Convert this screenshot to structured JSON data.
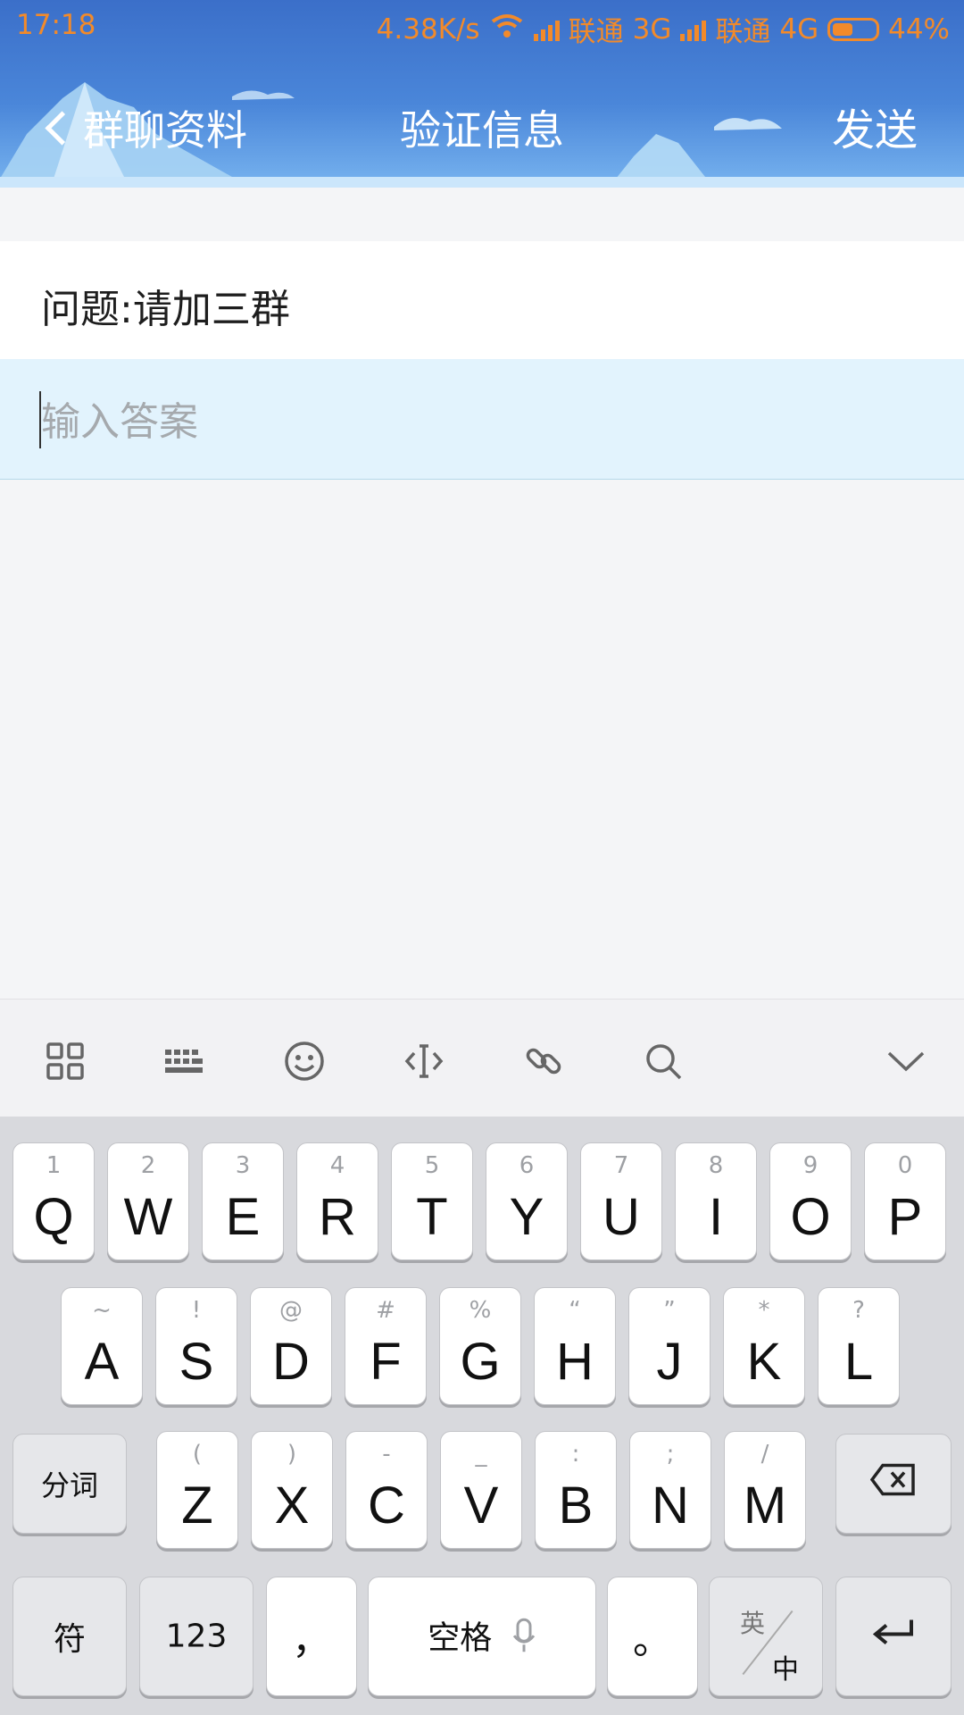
{
  "status_bar": {
    "time": "17:18",
    "net_speed": "4.38K/s",
    "carrier1": "联通",
    "net1": "3G",
    "carrier2": "联通",
    "net2": "4G",
    "battery": "44%",
    "color": "#f28a2a"
  },
  "nav": {
    "back_label": "群聊资料",
    "title": "验证信息",
    "send_label": "发送"
  },
  "form": {
    "question": "问题:请加三群",
    "answer_value": "",
    "answer_placeholder": "输入答案"
  },
  "keyboard_toolbar": [
    "grid-icon",
    "keyboard-icon",
    "emoji-icon",
    "cursor-icon",
    "link-icon",
    "search-icon",
    "collapse-icon"
  ],
  "keyboard": {
    "row1": [
      {
        "hint": "1",
        "key": "Q"
      },
      {
        "hint": "2",
        "key": "W"
      },
      {
        "hint": "3",
        "key": "E"
      },
      {
        "hint": "4",
        "key": "R"
      },
      {
        "hint": "5",
        "key": "T"
      },
      {
        "hint": "6",
        "key": "Y"
      },
      {
        "hint": "7",
        "key": "U"
      },
      {
        "hint": "8",
        "key": "I"
      },
      {
        "hint": "9",
        "key": "O"
      },
      {
        "hint": "0",
        "key": "P"
      }
    ],
    "row2": [
      {
        "hint": "~",
        "key": "A"
      },
      {
        "hint": "!",
        "key": "S"
      },
      {
        "hint": "@",
        "key": "D"
      },
      {
        "hint": "#",
        "key": "F"
      },
      {
        "hint": "%",
        "key": "G"
      },
      {
        "hint": "“",
        "key": "H"
      },
      {
        "hint": "”",
        "key": "J"
      },
      {
        "hint": "*",
        "key": "K"
      },
      {
        "hint": "?",
        "key": "L"
      }
    ],
    "row3": [
      {
        "hint": "(",
        "key": "Z"
      },
      {
        "hint": ")",
        "key": "X"
      },
      {
        "hint": "-",
        "key": "C"
      },
      {
        "hint": "_",
        "key": "V"
      },
      {
        "hint": ":",
        "key": "B"
      },
      {
        "hint": ";",
        "key": "N"
      },
      {
        "hint": "/",
        "key": "M"
      }
    ],
    "segment_label": "分词",
    "symbol_label": "符",
    "num_label": "123",
    "comma": "，",
    "space_label": "空格",
    "period": "。",
    "lang_en": "英",
    "lang_zh": "中"
  }
}
